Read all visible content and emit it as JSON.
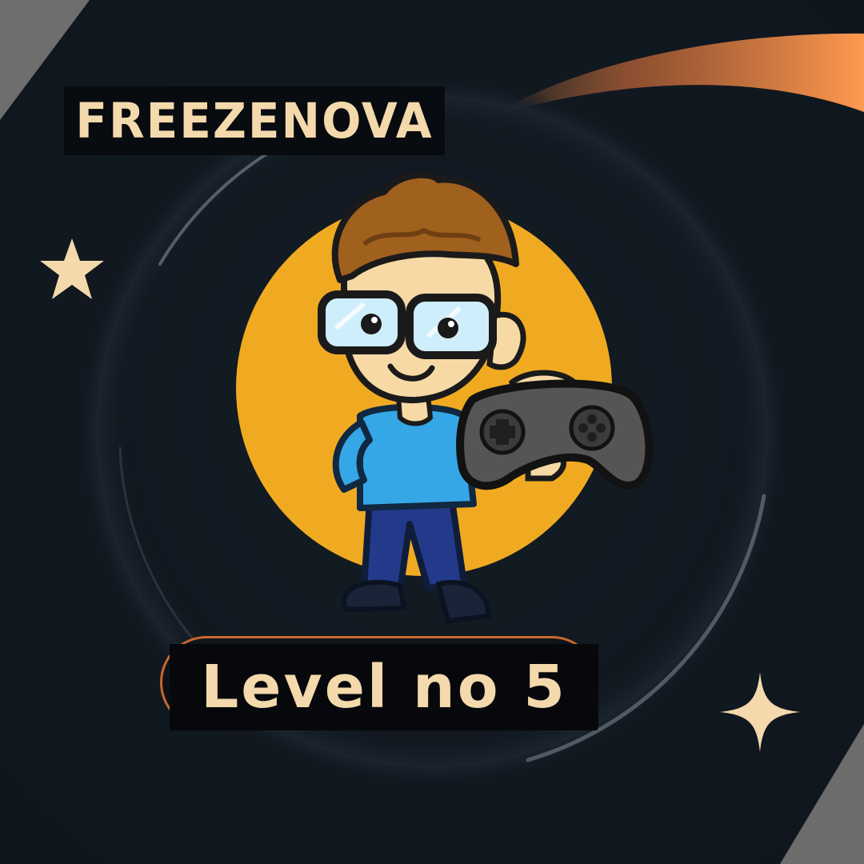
{
  "brand": {
    "title": "FREEZENOVA"
  },
  "level": {
    "label": "Level no 5"
  },
  "colors": {
    "background": "#111820",
    "accent_text": "#f3d9ab",
    "sun_disc": "#f0aa22",
    "swoosh": "#ff9a50",
    "pill_border": "#c8672c",
    "shirt": "#35a6e6",
    "pants": "#233a8a",
    "controller": "#555555",
    "star": "#f3d9ab"
  },
  "icons": {
    "star_left": "star-icon",
    "star_right": "sparkle-icon",
    "character": "gamer-character-icon",
    "controller": "gamepad-icon"
  }
}
